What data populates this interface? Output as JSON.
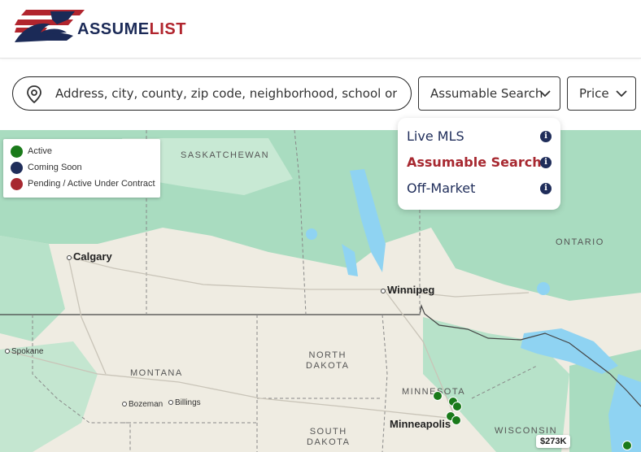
{
  "header": {
    "logo_word1": "ASSUME",
    "logo_word2": "LIST",
    "brand_navy": "#1b2a57",
    "brand_red": "#b1252e"
  },
  "search": {
    "placeholder": "Address, city, county, zip code, neighborhood, school or MLS #",
    "icon": "map-pin-icon"
  },
  "filters": {
    "listing_type_label": "Assumable Search",
    "price_label": "Price"
  },
  "listing_type_menu": {
    "items": [
      {
        "label": "Live MLS",
        "selected": false
      },
      {
        "label": "Assumable Search",
        "selected": true
      },
      {
        "label": "Off-Market",
        "selected": false
      }
    ],
    "info_glyph": "i"
  },
  "legend": {
    "items": [
      {
        "label": "Active",
        "color": "#1a7a1a"
      },
      {
        "label": "Coming Soon",
        "color": "#1f2d5a"
      },
      {
        "label": "Pending / Active Under Contract",
        "color": "#a72830"
      }
    ]
  },
  "map": {
    "regions": {
      "saskatchewan": "SASKATCHEWAN",
      "ontario": "ONTARIO",
      "montana": "MONTANA",
      "north_dakota_1": "NORTH",
      "north_dakota_2": "DAKOTA",
      "south_dakota_1": "SOUTH",
      "south_dakota_2": "DAKOTA",
      "minnesota": "MINNESOTA",
      "wisconsin": "WISCONSIN"
    },
    "cities": {
      "calgary": "Calgary",
      "winnipeg": "Winnipeg",
      "spokane": "Spokane",
      "bozeman": "Bozeman",
      "billings": "Billings",
      "minneapolis": "Minneapolis"
    },
    "price_tag": "$273K",
    "water_color": "#8fd3f2",
    "forest_color": "#a9dcc0"
  }
}
